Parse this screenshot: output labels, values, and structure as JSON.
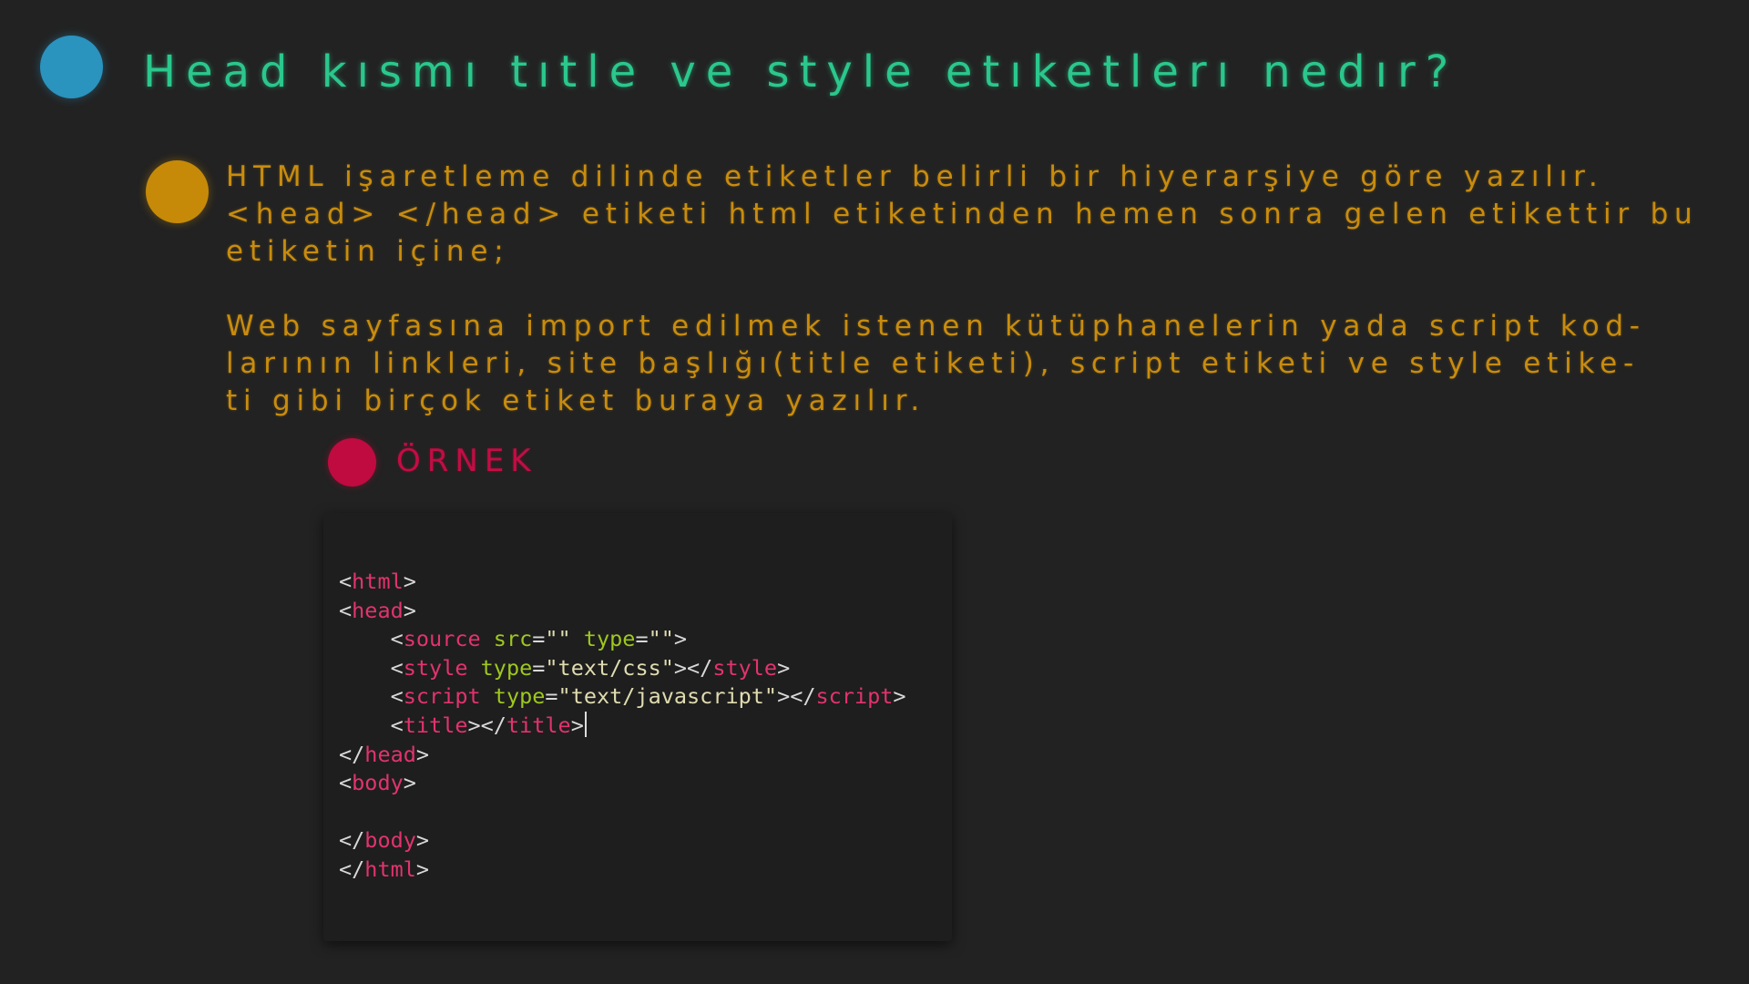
{
  "slide": {
    "title": "Head kısmı tıtle ve style etıketlerı nedır?",
    "body_paragraph_1": [
      "HTML işaretleme dilinde etiketler belirli bir hiyerarşiye göre yazılır.",
      "<head> </head> etiketi html etiketinden hemen sonra gelen etikettir bu",
      "etiketin içine;"
    ],
    "body_paragraph_2": [
      "Web sayfasına import edilmek istenen kütüphanelerin yada script kod-",
      "larının linkleri, site başlığı(title etiketi), script etiketi ve style etike-",
      "ti gibi birçok etiket buraya yazılır."
    ],
    "example_label": "ÖRNEK"
  },
  "colors": {
    "background": "#222222",
    "title": "#2bc78c",
    "body_text": "#c88c0e",
    "example_label": "#c20d44",
    "bullet_title": "#2a93be",
    "bullet_body": "#c68a08",
    "bullet_example": "#bf0b3f",
    "code_tag": "#e2336d",
    "code_attr": "#9ec81e"
  },
  "code_example": {
    "lines": [
      [
        {
          "t": "p",
          "v": "<"
        },
        {
          "t": "tag",
          "v": "html"
        },
        {
          "t": "p",
          "v": ">"
        }
      ],
      [
        {
          "t": "p",
          "v": "<"
        },
        {
          "t": "tag",
          "v": "head"
        },
        {
          "t": "p",
          "v": ">"
        }
      ],
      [
        {
          "t": "p",
          "v": "    <"
        },
        {
          "t": "tag",
          "v": "source"
        },
        {
          "t": "p",
          "v": " "
        },
        {
          "t": "attr",
          "v": "src"
        },
        {
          "t": "p",
          "v": "="
        },
        {
          "t": "str",
          "v": "\"\""
        },
        {
          "t": "p",
          "v": " "
        },
        {
          "t": "attr",
          "v": "type"
        },
        {
          "t": "p",
          "v": "="
        },
        {
          "t": "str",
          "v": "\"\""
        },
        {
          "t": "p",
          "v": ">"
        }
      ],
      [
        {
          "t": "p",
          "v": "    <"
        },
        {
          "t": "tag",
          "v": "style"
        },
        {
          "t": "p",
          "v": " "
        },
        {
          "t": "attr",
          "v": "type"
        },
        {
          "t": "p",
          "v": "="
        },
        {
          "t": "str",
          "v": "\"text/css\""
        },
        {
          "t": "p",
          "v": "></"
        },
        {
          "t": "tag",
          "v": "style"
        },
        {
          "t": "p",
          "v": ">"
        }
      ],
      [
        {
          "t": "p",
          "v": "    <"
        },
        {
          "t": "tag",
          "v": "script"
        },
        {
          "t": "p",
          "v": " "
        },
        {
          "t": "attr",
          "v": "type"
        },
        {
          "t": "p",
          "v": "="
        },
        {
          "t": "str",
          "v": "\"text/javascript\""
        },
        {
          "t": "p",
          "v": "></"
        },
        {
          "t": "tag",
          "v": "script"
        },
        {
          "t": "p",
          "v": ">"
        }
      ],
      [
        {
          "t": "p",
          "v": "    <"
        },
        {
          "t": "tag",
          "v": "title"
        },
        {
          "t": "p",
          "v": "></"
        },
        {
          "t": "tag",
          "v": "title"
        },
        {
          "t": "p",
          "v": ">"
        },
        {
          "t": "caret",
          "v": ""
        }
      ],
      [
        {
          "t": "p",
          "v": "</"
        },
        {
          "t": "tag",
          "v": "head"
        },
        {
          "t": "p",
          "v": ">"
        }
      ],
      [
        {
          "t": "p",
          "v": "<"
        },
        {
          "t": "tag",
          "v": "body"
        },
        {
          "t": "p",
          "v": ">"
        }
      ],
      [],
      [
        {
          "t": "p",
          "v": "</"
        },
        {
          "t": "tag",
          "v": "body"
        },
        {
          "t": "p",
          "v": ">"
        }
      ],
      [
        {
          "t": "p",
          "v": "</"
        },
        {
          "t": "tag",
          "v": "html"
        },
        {
          "t": "p",
          "v": ">"
        }
      ]
    ]
  }
}
